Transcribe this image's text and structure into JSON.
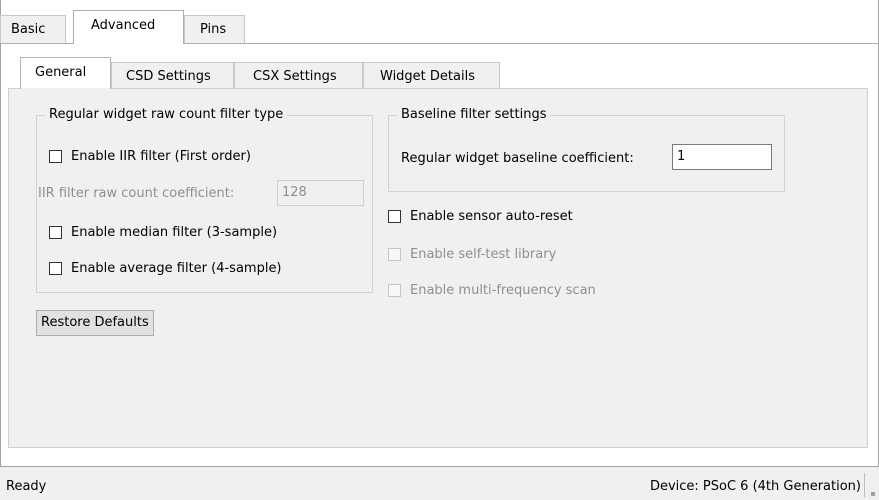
{
  "top_tabs": [
    "Basic",
    "Advanced",
    "Pins"
  ],
  "active_top_tab": "Advanced",
  "sub_tabs": [
    "General",
    "CSD Settings",
    "CSX Settings",
    "Widget Details"
  ],
  "active_sub_tab": "General",
  "raw_filter_group": {
    "title": "Regular widget raw count filter type",
    "iir_label": "Enable IIR filter (First order)",
    "iir_checked": false,
    "iir_coeff_label": "IIR filter raw count coefficient:",
    "iir_coeff_value": "128",
    "median_label": "Enable median filter (3-sample)",
    "median_checked": false,
    "average_label": "Enable average filter (4-sample)",
    "average_checked": false
  },
  "baseline_group": {
    "title": "Baseline filter settings",
    "coeff_label": "Regular widget baseline coefficient:",
    "coeff_value": "1"
  },
  "options": {
    "auto_reset_label": "Enable sensor auto-reset",
    "auto_reset_checked": false,
    "self_test_label": "Enable self-test library",
    "self_test_enabled": false,
    "multi_freq_label": "Enable multi-frequency scan",
    "multi_freq_enabled": false
  },
  "restore_defaults_label": "Restore Defaults",
  "status": {
    "left": "Ready",
    "device": "Device: PSoC 6 (4th Generation)"
  }
}
